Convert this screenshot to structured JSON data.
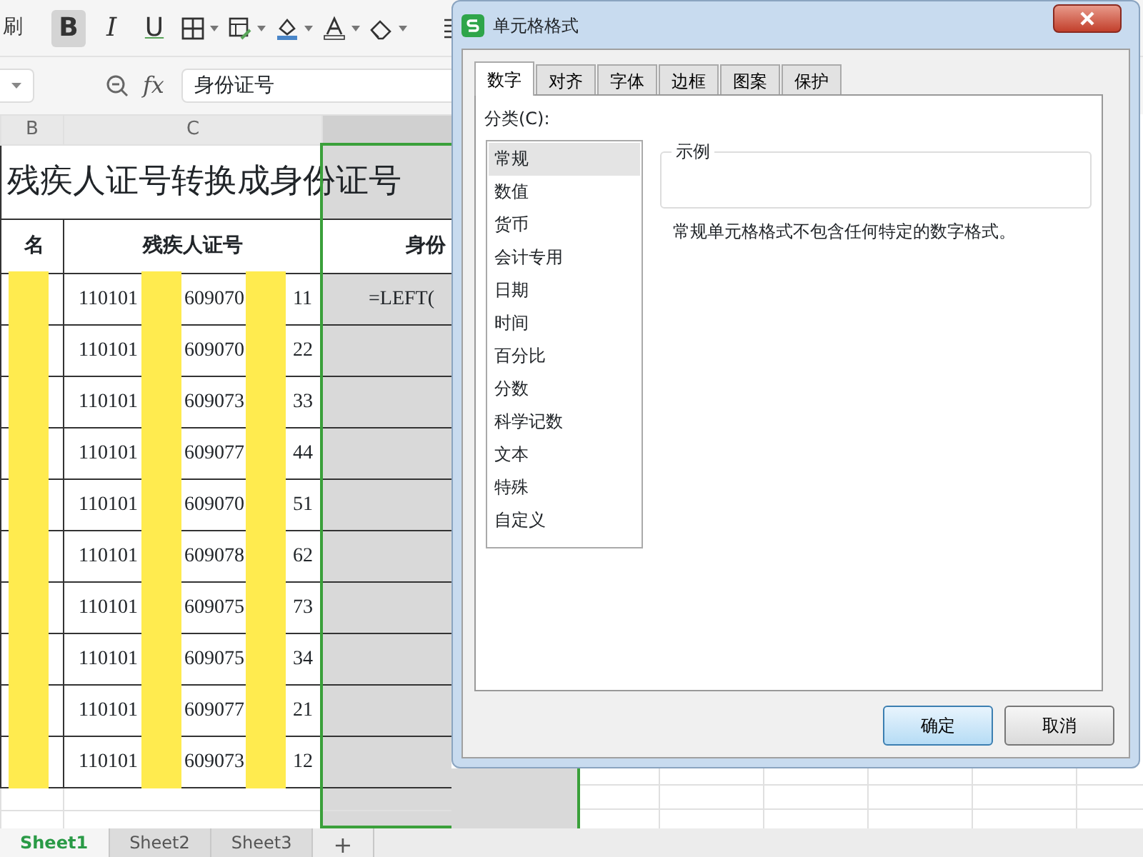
{
  "toolbar": {
    "painter_label": "刷",
    "buttons": [
      {
        "kind": "bold",
        "label": "B",
        "selected": true
      },
      {
        "kind": "italic",
        "label": "I",
        "selected": false
      },
      {
        "kind": "underline",
        "label": "U",
        "selected": false
      },
      {
        "kind": "borders"
      },
      {
        "kind": "cell-style"
      },
      {
        "kind": "fill"
      },
      {
        "kind": "font-color"
      },
      {
        "kind": "eraser"
      },
      {
        "kind": "align"
      }
    ]
  },
  "formula_bar": {
    "fx": "fx",
    "value": "身份证号"
  },
  "column_headers": [
    "B",
    "C"
  ],
  "sheet": {
    "title": "残疾人证号转换成身份证号",
    "headers": [
      "名",
      "残疾人证号",
      "身份"
    ],
    "rows": [
      {
        "id": [
          "110101",
          "609070",
          "11"
        ],
        "formula": "=LEFT("
      },
      {
        "id": [
          "110101",
          "609070",
          "22"
        ]
      },
      {
        "id": [
          "110101",
          "609073",
          "33"
        ]
      },
      {
        "id": [
          "110101",
          "609077",
          "44"
        ]
      },
      {
        "id": [
          "110101",
          "609070",
          "51"
        ]
      },
      {
        "id": [
          "110101",
          "609078",
          "62"
        ]
      },
      {
        "id": [
          "110101",
          "609075",
          "73"
        ]
      },
      {
        "id": [
          "110101",
          "609075",
          "34"
        ]
      },
      {
        "id": [
          "110101",
          "609077",
          "21"
        ]
      },
      {
        "id": [
          "110101",
          "609073",
          "12"
        ]
      }
    ]
  },
  "sheet_tabs": [
    {
      "label": "Sheet1",
      "selected": true
    },
    {
      "label": "Sheet2",
      "selected": false
    },
    {
      "label": "Sheet3",
      "selected": false
    }
  ],
  "add_sheet": "+",
  "dialog": {
    "title": "单元格格式",
    "tabs": [
      {
        "label": "数字",
        "selected": true
      },
      {
        "label": "对齐",
        "selected": false
      },
      {
        "label": "字体",
        "selected": false
      },
      {
        "label": "边框",
        "selected": false
      },
      {
        "label": "图案",
        "selected": false
      },
      {
        "label": "保护",
        "selected": false
      }
    ],
    "category_label": "分类(C):",
    "categories": [
      {
        "label": "常规",
        "selected": true
      },
      {
        "label": "数值",
        "selected": false
      },
      {
        "label": "货币",
        "selected": false
      },
      {
        "label": "会计专用",
        "selected": false
      },
      {
        "label": "日期",
        "selected": false
      },
      {
        "label": "时间",
        "selected": false
      },
      {
        "label": "百分比",
        "selected": false
      },
      {
        "label": "分数",
        "selected": false
      },
      {
        "label": "科学记数",
        "selected": false
      },
      {
        "label": "文本",
        "selected": false
      },
      {
        "label": "特殊",
        "selected": false
      },
      {
        "label": "自定义",
        "selected": false
      }
    ],
    "sample_label": "示例",
    "description": "常规单元格格式不包含任何特定的数字格式。",
    "buttons": [
      {
        "label": "确定",
        "default": true
      },
      {
        "label": "取消",
        "default": false
      }
    ]
  }
}
